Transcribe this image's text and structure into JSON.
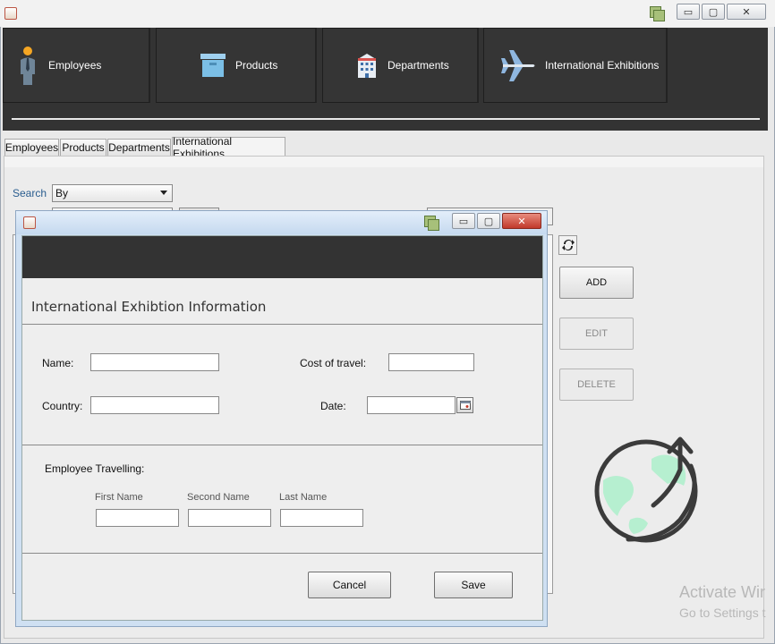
{
  "window": {
    "controls": {
      "minimize": "▭",
      "maximize": "▢",
      "close": "✕"
    }
  },
  "nav": {
    "buttons": [
      {
        "label": "Employees",
        "icon": "person-icon"
      },
      {
        "label": "Products",
        "icon": "box-icon"
      },
      {
        "label": "Departments",
        "icon": "building-icon"
      },
      {
        "label": "International Exhibitions",
        "icon": "airplane-icon"
      }
    ]
  },
  "tabs": [
    "Employees",
    "Products",
    "Departments",
    "International Exhibitions"
  ],
  "active_tab": "International Exhibitions",
  "search": {
    "label": "Search",
    "by_value": "By"
  },
  "actions": {
    "add": "ADD",
    "edit": "EDIT",
    "delete": "DELETE",
    "refresh_icon": "refresh-icon"
  },
  "watermark": {
    "line1": "Activate Wir",
    "line2": "Go to Settings t"
  },
  "dialog": {
    "controls": {
      "minimize": "▭",
      "maximize": "▢",
      "close": "✕"
    },
    "heading": "International Exhibtion Information",
    "fields": {
      "name_label": "Name:",
      "name_value": "",
      "country_label": "Country:",
      "country_value": "",
      "cost_label": "Cost of travel:",
      "cost_value": "",
      "date_label": "Date:",
      "date_value": ""
    },
    "employee": {
      "section_label": "Employee Travelling:",
      "first_name_label": "First Name",
      "second_name_label": "Second Name",
      "last_name_label": "Last Name",
      "first_name_value": "",
      "second_name_value": "",
      "last_name_value": ""
    },
    "buttons": {
      "cancel": "Cancel",
      "save": "Save"
    }
  },
  "colors": {
    "nav_bg": "#333333",
    "globe_fill": "#b6efd0",
    "globe_stroke": "#3b3b3b",
    "link_blue": "#2a5d8f"
  }
}
